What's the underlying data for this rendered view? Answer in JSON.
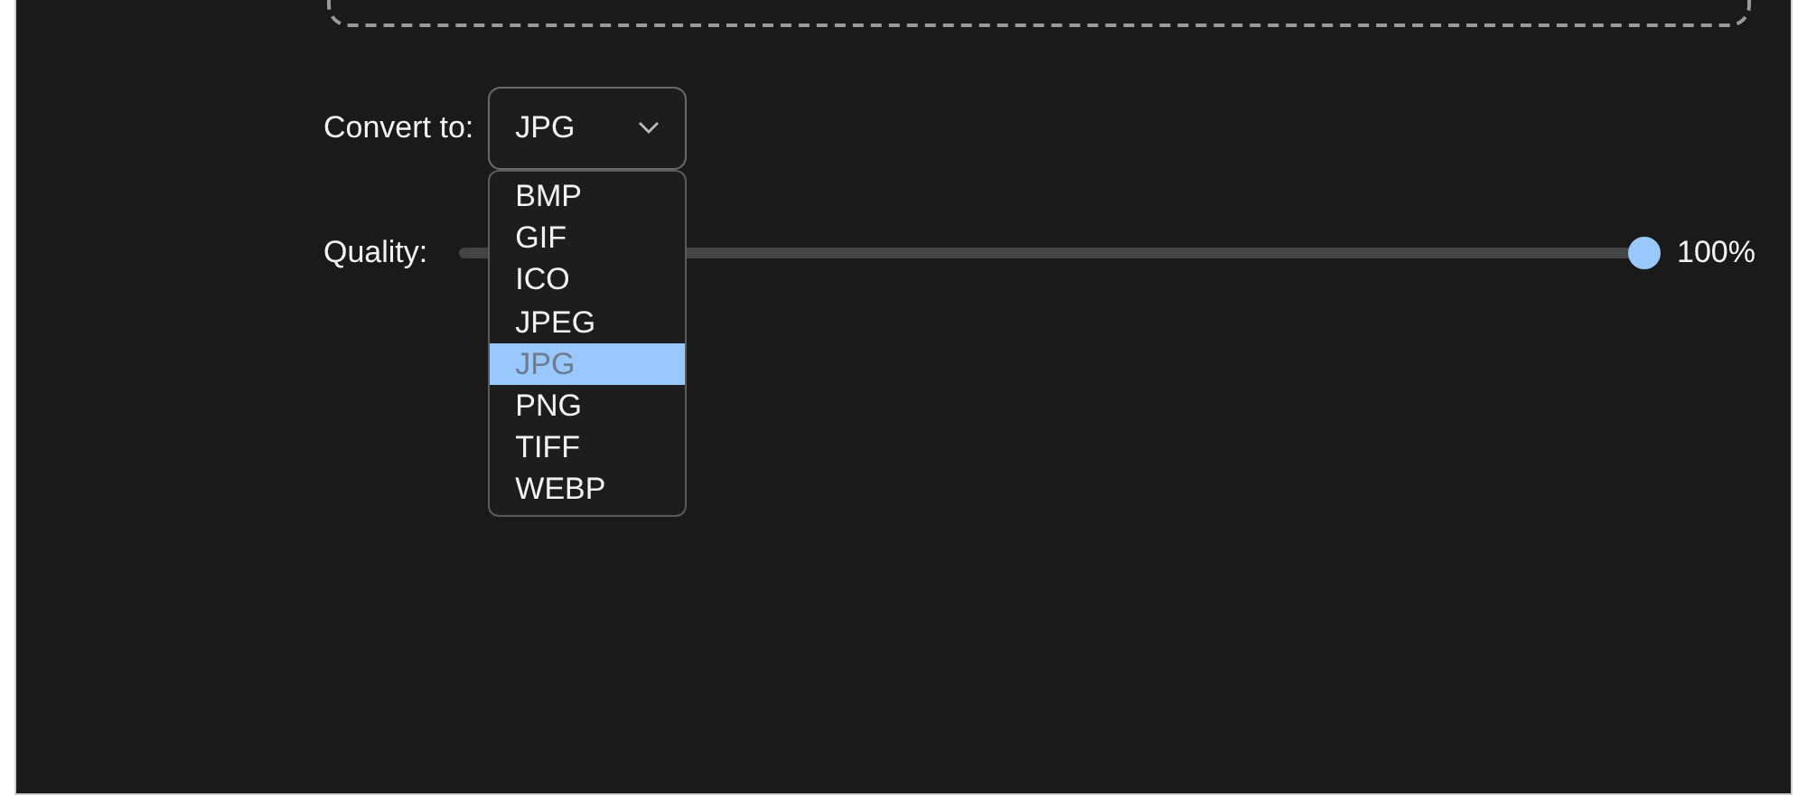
{
  "convert": {
    "label": "Convert to:",
    "value": "JPG",
    "expanded": true,
    "options": [
      {
        "label": "BMP",
        "selected": false
      },
      {
        "label": "GIF",
        "selected": false
      },
      {
        "label": "ICO",
        "selected": false
      },
      {
        "label": "JPEG",
        "selected": false
      },
      {
        "label": "JPG",
        "selected": true
      },
      {
        "label": "PNG",
        "selected": false
      },
      {
        "label": "TIFF",
        "selected": false
      },
      {
        "label": "WEBP",
        "selected": false
      }
    ]
  },
  "quality": {
    "label": "Quality:",
    "level": 1,
    "reading": "100%"
  }
}
